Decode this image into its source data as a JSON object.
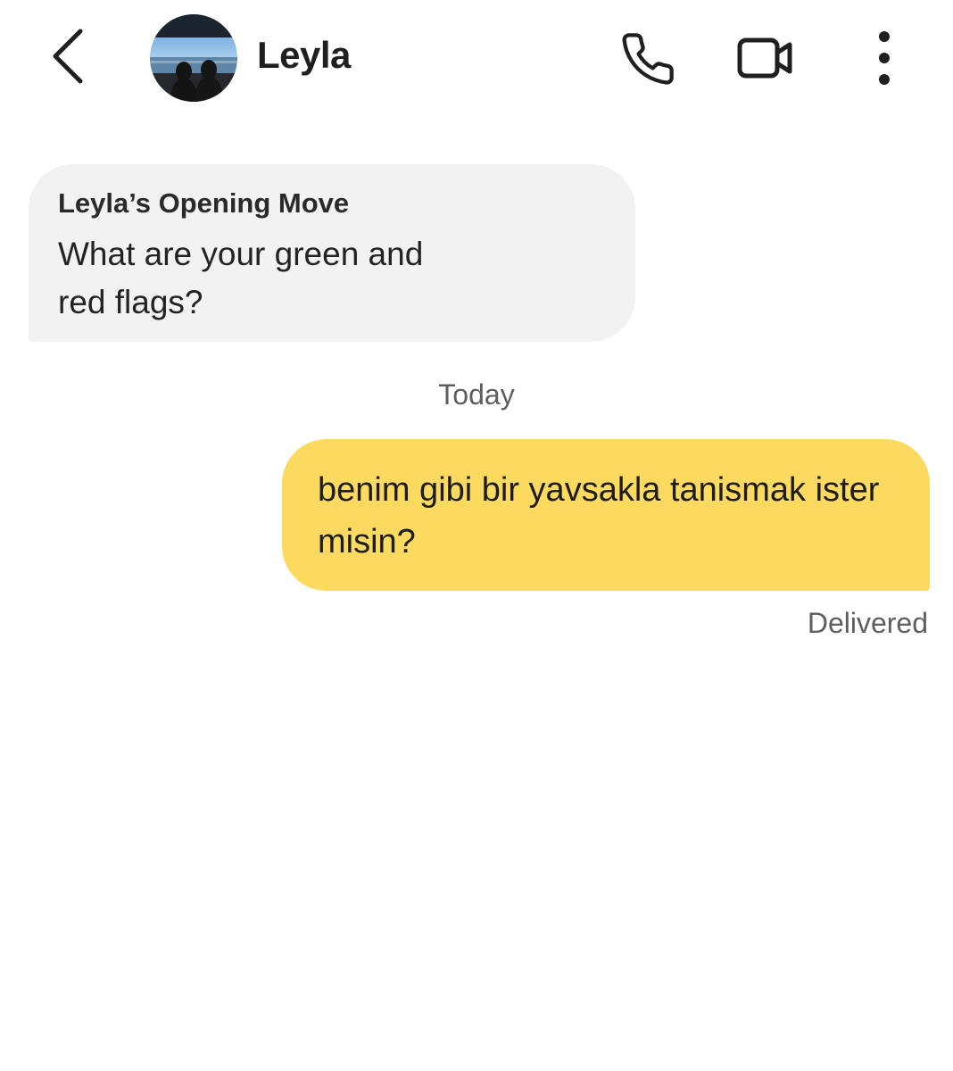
{
  "header": {
    "contact_name": "Leyla",
    "back_icon": "chevron-left-icon",
    "call_icon": "phone-icon",
    "video_icon": "video-camera-icon",
    "more_icon": "more-vertical-icon"
  },
  "messages": {
    "incoming": {
      "title": "Leyla’s Opening Move",
      "text": "What are your green and red flags?"
    },
    "day_separator": "Today",
    "outgoing": {
      "text": "benim gibi bir yavsakla tanismak ister misin?",
      "status": "Delivered"
    }
  },
  "colors": {
    "incoming_bubble": "#f2f2f2",
    "outgoing_bubble": "#fcd95f",
    "secondary_text": "#5e5e5e"
  }
}
